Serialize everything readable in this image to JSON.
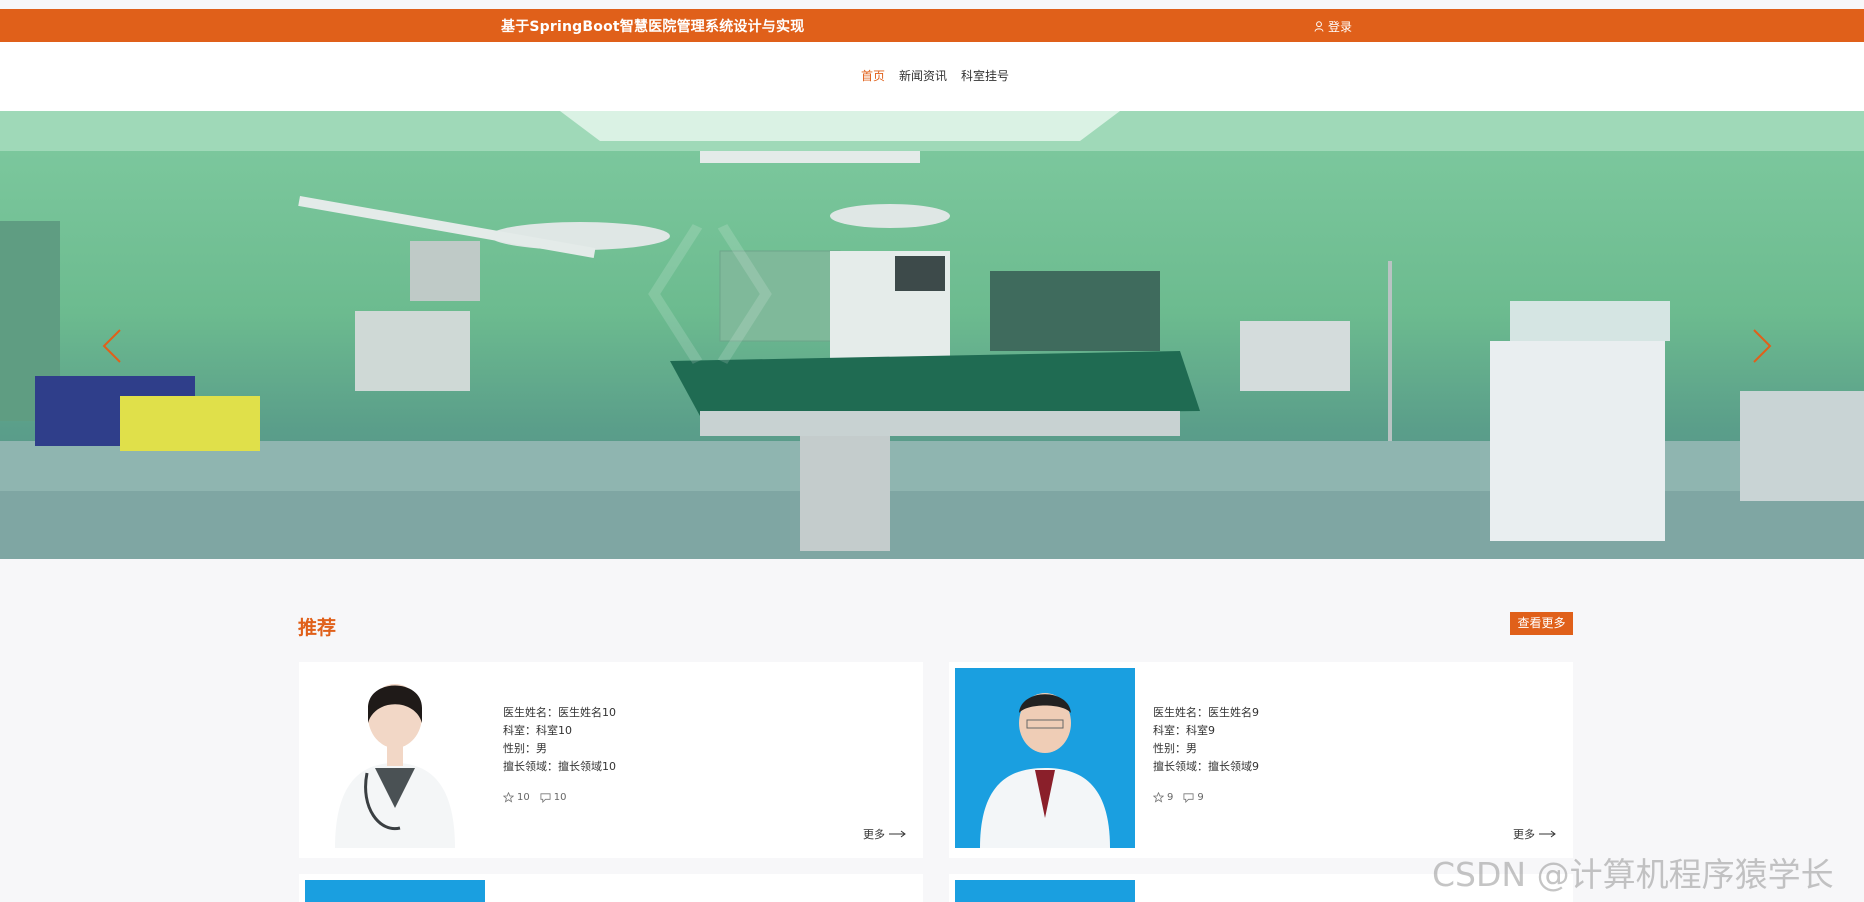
{
  "header": {
    "site_title": "基于SpringBoot智慧医院管理系统设计与实现",
    "login_label": "登录",
    "brand_color": "#e0601a"
  },
  "nav": {
    "items": [
      {
        "label": "首页",
        "active": true
      },
      {
        "label": "新闻资讯",
        "active": false
      },
      {
        "label": "科室挂号",
        "active": false
      }
    ]
  },
  "banner": {
    "prev_icon": "chevron-left-icon",
    "next_icon": "chevron-right-icon"
  },
  "recommend": {
    "title": "推荐",
    "more_label": "查看更多",
    "cards": [
      {
        "name_label": "医生姓名：",
        "name": "医生姓名10",
        "dept_label": "科室：",
        "dept": "科室10",
        "gender_label": "性别：",
        "gender": "男",
        "field_label": "擅长领域：",
        "field": "擅长领域10",
        "likes": "10",
        "collects": "10",
        "more": "更多"
      },
      {
        "name_label": "医生姓名：",
        "name": "医生姓名9",
        "dept_label": "科室：",
        "dept": "科室9",
        "gender_label": "性别：",
        "gender": "男",
        "field_label": "擅长领域：",
        "field": "擅长领域9",
        "likes": "9",
        "collects": "9",
        "more": "更多"
      }
    ]
  },
  "watermark": "CSDN @计算机程序猿学长"
}
